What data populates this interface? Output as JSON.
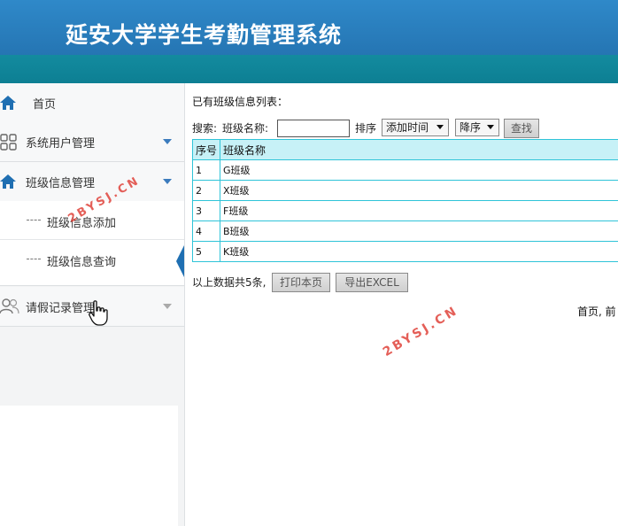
{
  "header": {
    "title": "延安大学学生考勤管理系统"
  },
  "sidebar": {
    "items": [
      {
        "label": "首页",
        "icon": "home-icon"
      },
      {
        "label": "系统用户管理",
        "icon": "grid-icon"
      },
      {
        "label": "班级信息管理",
        "icon": "home-icon"
      },
      {
        "label": "请假记录管理",
        "icon": "users-icon"
      }
    ],
    "submenu": [
      {
        "label": "班级信息添加"
      },
      {
        "label": "班级信息查询"
      }
    ]
  },
  "main": {
    "heading": "已有班级信息列表：",
    "search": {
      "label": "搜索:",
      "field_label": "班级名称:",
      "field_value": "",
      "sort_label": "排序",
      "sort_field": "添加时间",
      "sort_order": "降序",
      "button": "查找"
    },
    "table": {
      "headers": [
        "序号",
        "班级名称"
      ],
      "rows": [
        [
          "1",
          "G班级"
        ],
        [
          "2",
          "X班级"
        ],
        [
          "3",
          "F班级"
        ],
        [
          "4",
          "B班级"
        ],
        [
          "5",
          "K班级"
        ]
      ]
    },
    "summary": {
      "text": "以上数据共5条,",
      "print_button": "打印本页",
      "export_button": "导出EXCEL"
    },
    "pager": {
      "text": "首页, 前"
    }
  },
  "watermark": {
    "text": "2BYSJ.CN"
  },
  "colors": {
    "header": "#2d7fbf",
    "header_band": "#0f8599",
    "table_border": "#2fc4d8",
    "table_header_bg": "#c7f1f7",
    "sidebar_accent": "#1f6fb2",
    "watermark": "#e0443c"
  }
}
